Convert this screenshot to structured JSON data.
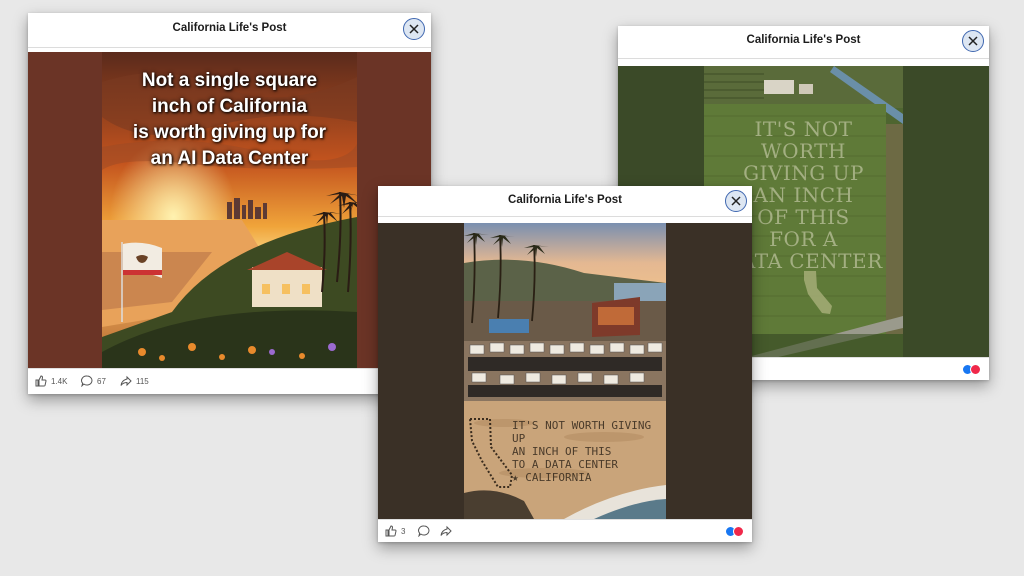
{
  "posts": [
    {
      "title": "California Life's Post",
      "overlay_lines": [
        "Not a single square",
        "inch of California",
        "is worth giving up for",
        "an AI Data Center"
      ],
      "likes": "1.4K",
      "comments": "67",
      "shares": "115"
    },
    {
      "title": "California Life's Post",
      "field_lines": [
        "IT'S NOT",
        "WORTH",
        "GIVING UP",
        "AN INCH",
        "OF THIS",
        "FOR A",
        "DATA CENTER"
      ]
    },
    {
      "title": "California Life's Post",
      "sand_lines": [
        "IT'S NOT WORTH GIVING UP",
        "AN INCH OF THIS",
        "TO A DATA CENTER",
        "★ CALIFORNIA"
      ],
      "likes": "3"
    }
  ],
  "colors": {
    "like": "#1877f2",
    "love": "#f0284a",
    "close_border": "#3f67b0",
    "media_bg_1": "#6b3426",
    "media_bg_2": "#3b4a28",
    "media_bg_3": "#3a3026"
  },
  "icons": [
    "close-icon",
    "like-icon",
    "comment-icon",
    "share-icon",
    "like-reaction-icon",
    "love-reaction-icon"
  ]
}
